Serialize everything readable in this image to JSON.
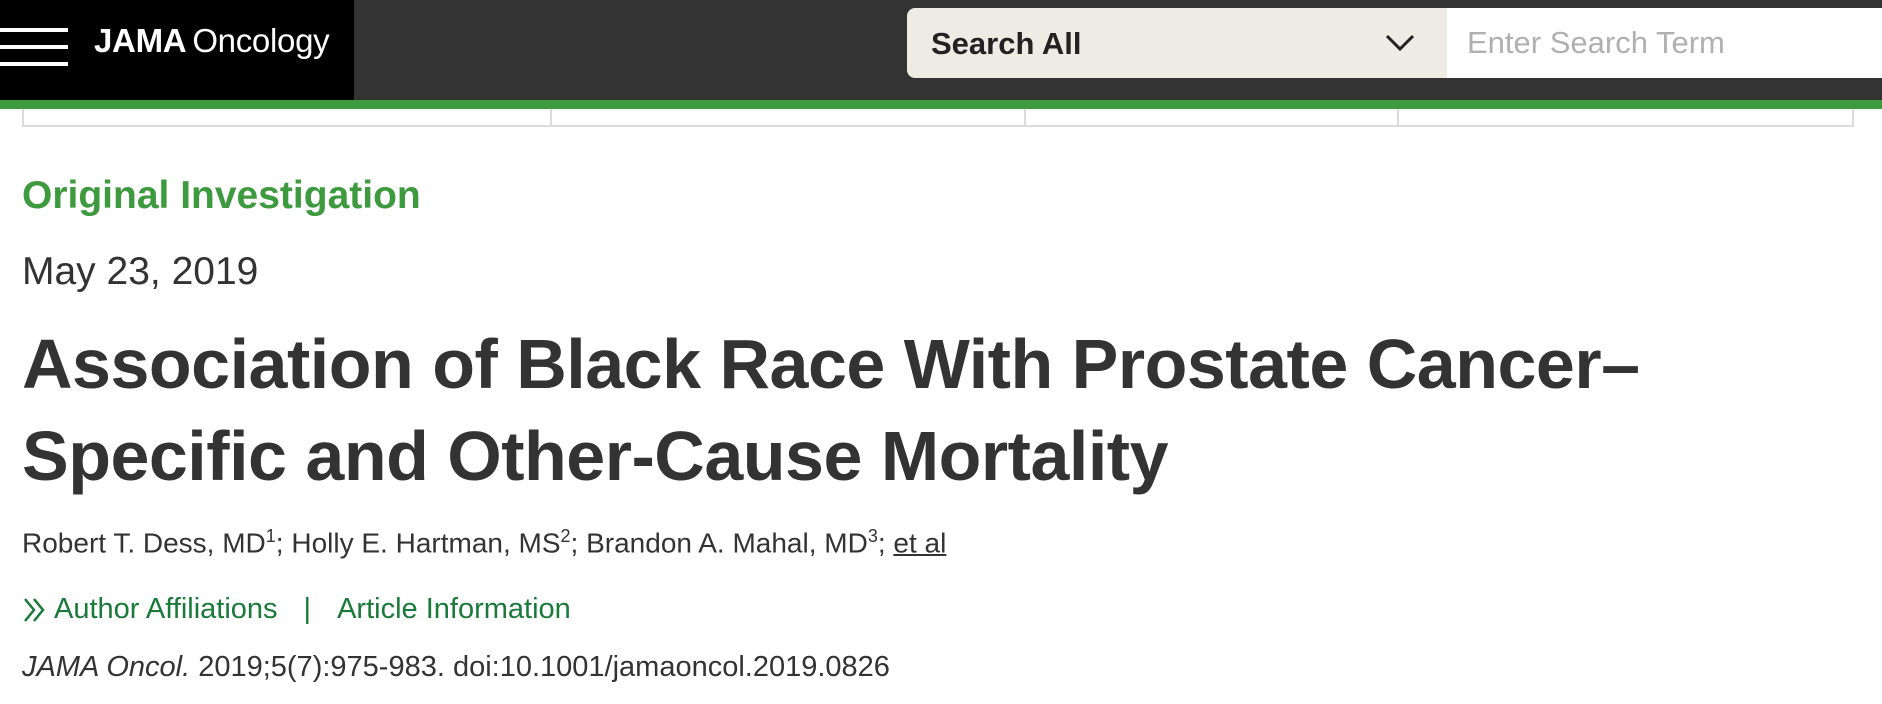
{
  "header": {
    "brand_strong": "JAMA",
    "brand_light": "Oncology",
    "search_scope": "Search All",
    "search_placeholder": "Enter Search Term"
  },
  "article": {
    "type": "Original Investigation",
    "date": "May 23, 2019",
    "title": "Association of Black Race With Prostate Cancer–Specific and Other-Cause Mortality",
    "authors": [
      {
        "name": "Robert T. Dess, MD",
        "affiliation": "1"
      },
      {
        "name": "Holly E. Hartman, MS",
        "affiliation": "2"
      },
      {
        "name": "Brandon A. Mahal, MD",
        "affiliation": "3"
      }
    ],
    "et_al": "et al",
    "links": {
      "affiliations": "Author Affiliations",
      "separator": "|",
      "article_info": "Article Information"
    },
    "citation": {
      "journal": "JAMA Oncol.",
      "details": "2019;5(7):975-983. doi:10.1001/jamaoncol.2019.0826"
    }
  },
  "colors": {
    "brand_green": "#3e9a3e",
    "link_green": "#1a7a3a",
    "topbar": "#333333",
    "brand_block": "#000000",
    "search_scope_bg": "#edece4"
  },
  "icons": [
    "hamburger-menu-icon",
    "chevron-down-icon",
    "double-chevron-right-icon"
  ]
}
